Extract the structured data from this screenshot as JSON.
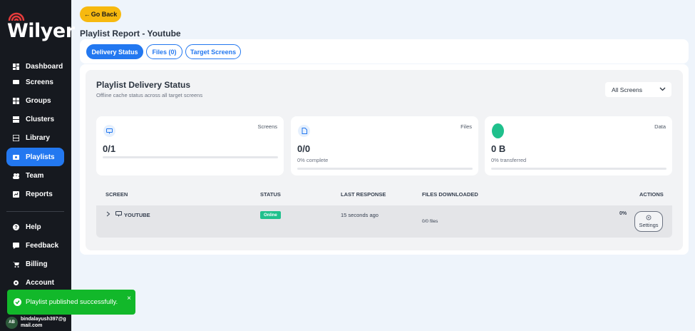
{
  "brand": {
    "name": "Wilyer"
  },
  "sidebar": {
    "items": [
      {
        "label": "Dashboard",
        "icon": "dashboard-icon"
      },
      {
        "label": "Screens",
        "icon": "screen-icon"
      },
      {
        "label": "Groups",
        "icon": "groups-icon"
      },
      {
        "label": "Clusters",
        "icon": "clusters-icon"
      },
      {
        "label": "Library",
        "icon": "library-icon"
      },
      {
        "label": "Playlists",
        "icon": "playlist-icon",
        "active": true
      },
      {
        "label": "Team",
        "icon": "team-icon"
      },
      {
        "label": "Reports",
        "icon": "reports-icon"
      }
    ],
    "bottom_items": [
      {
        "label": "Help",
        "icon": "help-icon"
      },
      {
        "label": "Feedback",
        "icon": "feedback-icon"
      },
      {
        "label": "Billing",
        "icon": "cart-icon"
      },
      {
        "label": "Account",
        "icon": "gear-icon"
      }
    ],
    "user": {
      "initials": "AB",
      "email": "bindalayush397@gmail.com"
    }
  },
  "toast": {
    "message": "Playlist published successfully.",
    "close": "×"
  },
  "header": {
    "back_label": "Go Back",
    "title": "Playlist Report - Youtube"
  },
  "tabs": [
    {
      "label": "Delivery Status",
      "active": true
    },
    {
      "label": "Files (0)"
    },
    {
      "label": "Target Screens"
    }
  ],
  "section": {
    "title": "Playlist Delivery Status",
    "subtitle": "Offline cache status across all target screens",
    "filter": "All Screens"
  },
  "cards": [
    {
      "label": "Screens",
      "value": "0/1",
      "sub": "",
      "progress": 0
    },
    {
      "label": "Files",
      "value": "0/0",
      "sub": "0% complete",
      "progress": 0
    },
    {
      "label": "Data",
      "value": "0 B",
      "sub": "0% transferred",
      "progress": 0
    }
  ],
  "table": {
    "headers": [
      "SCREEN",
      "STATUS",
      "LAST RESPONSE",
      "FILES DOWNLOADED",
      "ACTIONS"
    ],
    "rows": [
      {
        "screen": "YOUTUBE",
        "status": "Online",
        "last_response": "15 seconds ago",
        "files": "0/0 files",
        "percent": "0%",
        "action": "Settings"
      }
    ]
  },
  "colors": {
    "accent": "#2378f0",
    "sidebar_bg": "#16191f",
    "back_button": "#f7b90f",
    "toast": "#12b82a",
    "online": "#1fc08c"
  }
}
